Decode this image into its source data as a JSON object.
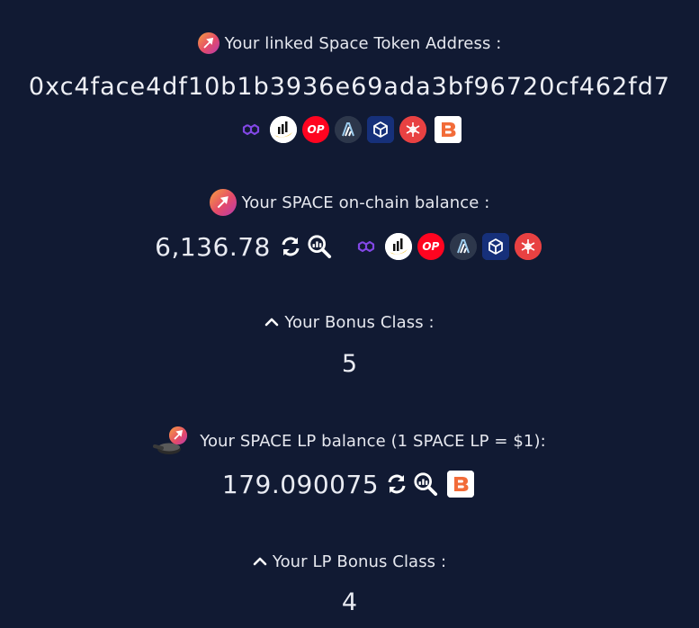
{
  "linked_address": {
    "label": "Your linked Space Token Address :",
    "value": "0xc4face4df10b1b3936e69ada3bf96720cf462fd7",
    "chain_icons": [
      "polygon-icon",
      "pancakeswap-icon",
      "optimism-icon",
      "arbitrum-icon",
      "zksync-icon",
      "avalanche-icon",
      "bitrue-icon"
    ]
  },
  "onchain_balance": {
    "label": "Your SPACE on-chain balance :",
    "value": "6,136.78",
    "chain_icons": [
      "polygon-icon",
      "pancakeswap-icon",
      "optimism-icon",
      "arbitrum-icon",
      "zksync-icon",
      "avalanche-icon"
    ]
  },
  "bonus_class": {
    "label": "Your Bonus Class :",
    "value": "5"
  },
  "lp_balance": {
    "label": "Your SPACE LP balance (1 SPACE LP = $1):",
    "value": "179.090075",
    "chain_icons": [
      "bitrue-icon"
    ]
  },
  "lp_bonus_class": {
    "label": "Your LP Bonus Class :",
    "value": "4"
  },
  "icons": {
    "op_text": "OP"
  },
  "colors": {
    "background": "#111a33",
    "text": "#e6e8ef",
    "optimism": "#ff0420",
    "avalanche": "#e84142",
    "polygon": "#8247e5"
  }
}
